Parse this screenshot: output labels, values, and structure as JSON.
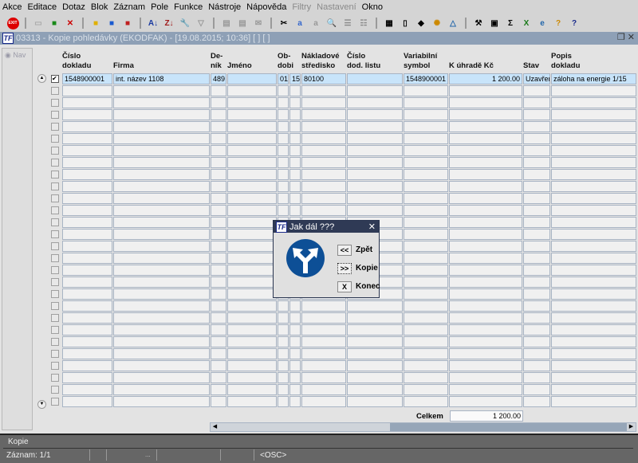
{
  "menu": [
    "Akce",
    "Editace",
    "Dotaz",
    "Blok",
    "Záznam",
    "Pole",
    "Funkce",
    "Nástroje",
    "Nápověda",
    "Filtry",
    "Nastavení",
    "Okno"
  ],
  "menu_disabled": [
    "Filtry",
    "Nastavení"
  ],
  "window": {
    "logo": "TF",
    "title": "03313 - Kopie pohledávky (EKODFAK) - [19.08.2015; 10:36]  [ ]  [ ]"
  },
  "nav_label": "Nav",
  "columns": [
    "Číslo\ndokladu",
    "Firma",
    "De-\nník",
    "Jméno",
    "Ob-\ndobi",
    "",
    "Nákladové\nstředisko",
    "Číslo\ndod. listu",
    "Variabilní\nsymbol",
    "K úhradě Kč",
    "Stav",
    "Popis\ndokladu"
  ],
  "row": [
    "1548900001",
    "int. název 1108",
    "489",
    "",
    "01",
    "15",
    "80100",
    "",
    "1548900001",
    "1 200.00",
    "Uzavřen",
    "záloha na energie 1/15"
  ],
  "total": {
    "label": "Celkem",
    "value": "1 200.00"
  },
  "dialog": {
    "title": "Jak dál ???",
    "buttons": [
      {
        "key": "<<",
        "label": "Zpět"
      },
      {
        "key": ">>",
        "label": "Kopie"
      },
      {
        "key": "X",
        "label": "Konec"
      }
    ]
  },
  "status": {
    "message": "Kopie",
    "record": "Záznam: 1/1",
    "dots": "...",
    "mode": "<OSC>"
  }
}
